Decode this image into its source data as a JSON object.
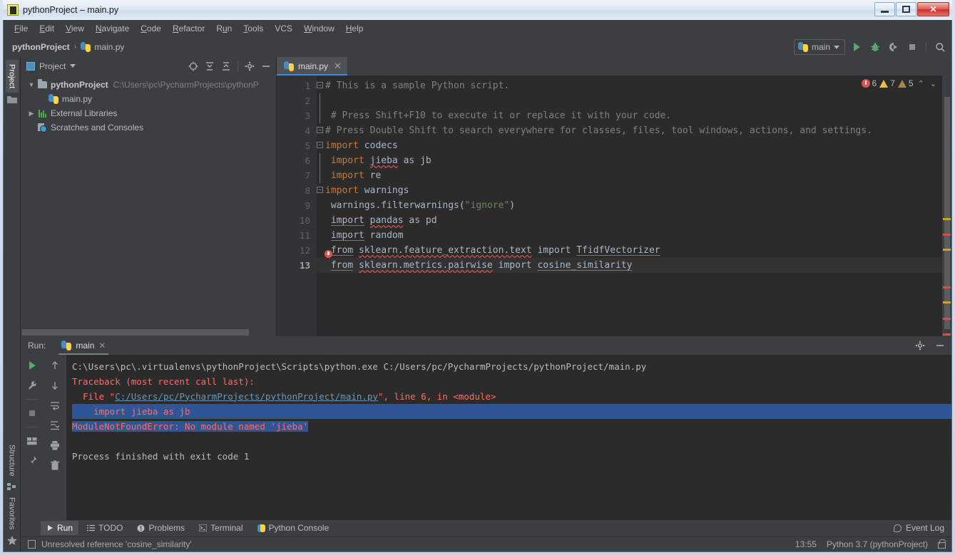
{
  "window": {
    "title": "pythonProject – main.py",
    "icon": "pycharm-icon",
    "minimize_label": "—",
    "maximize_label": "❐",
    "close_label": "✕"
  },
  "menubar": {
    "items": [
      {
        "label": "File",
        "mnemonic": "F"
      },
      {
        "label": "Edit",
        "mnemonic": "E"
      },
      {
        "label": "View",
        "mnemonic": "V"
      },
      {
        "label": "Navigate",
        "mnemonic": "N"
      },
      {
        "label": "Code",
        "mnemonic": "C"
      },
      {
        "label": "Refactor",
        "mnemonic": "R"
      },
      {
        "label": "Run",
        "mnemonic": "u"
      },
      {
        "label": "Tools",
        "mnemonic": "T"
      },
      {
        "label": "VCS",
        "mnemonic": ""
      },
      {
        "label": "Window",
        "mnemonic": "W"
      },
      {
        "label": "Help",
        "mnemonic": "H"
      }
    ]
  },
  "navbar": {
    "crumbs": [
      "pythonProject",
      "main.py"
    ],
    "separator": "›",
    "run_config": "main",
    "buttons": [
      "run-button",
      "debug-button",
      "run-coverage-button",
      "stop-button",
      "search-everywhere-button"
    ]
  },
  "left_toolbar": {
    "top": [
      "Project"
    ],
    "bottom": [
      "Structure",
      "Favorites"
    ]
  },
  "project_panel": {
    "title": "Project",
    "actions": [
      "select-opened-file-icon",
      "expand-all-icon",
      "collapse-all-icon",
      "settings-gear-icon",
      "hide-icon"
    ],
    "tree": [
      {
        "label": "pythonProject",
        "path": "C:\\Users\\pc\\PycharmProjects\\pythonP",
        "icon": "folder-icon",
        "arrow": "expanded",
        "depth": 0,
        "bold": true
      },
      {
        "label": "main.py",
        "path": "",
        "icon": "python-file-icon",
        "arrow": "none",
        "depth": 1,
        "bold": false
      },
      {
        "label": "External Libraries",
        "path": "",
        "icon": "libraries-icon",
        "arrow": "collapsed",
        "depth": 0,
        "bold": false
      },
      {
        "label": "Scratches and Consoles",
        "path": "",
        "icon": "scratches-icon",
        "arrow": "none",
        "depth": 0,
        "bold": false
      }
    ]
  },
  "editor": {
    "tabs": [
      {
        "label": "main.py",
        "icon": "python-file-icon",
        "active": true,
        "close": "✕"
      }
    ],
    "inspections": {
      "errors": "6",
      "warnings": "7",
      "weak_warnings": "5",
      "up": "⌃",
      "down": "⌄"
    },
    "current_line": 13,
    "lines": [
      {
        "num": "1",
        "fold": "start",
        "text": "# This is a sample Python script."
      },
      {
        "num": "2",
        "fold": "bar",
        "text": ""
      },
      {
        "num": "3",
        "fold": "bar",
        "text": " # Press Shift+F10 to execute it or replace it with your code."
      },
      {
        "num": "4",
        "fold": "end",
        "text": "# Press Double Shift to search everywhere for classes, files, tool windows, actions, and settings."
      },
      {
        "num": "5",
        "fold": "start",
        "text": "import codecs"
      },
      {
        "num": "6",
        "fold": "bar",
        "text": " import jieba as jb"
      },
      {
        "num": "7",
        "fold": "bar",
        "text": " import re"
      },
      {
        "num": "8",
        "fold": "end",
        "text": "import warnings"
      },
      {
        "num": "9",
        "fold": "none",
        "text": " warnings.filterwarnings(\"ignore\")"
      },
      {
        "num": "10",
        "fold": "none",
        "text": " import pandas as pd"
      },
      {
        "num": "11",
        "fold": "none",
        "text": " import random"
      },
      {
        "num": "12",
        "fold": "none",
        "text": " from sklearn.feature_extraction.text import TfidfVectorizer"
      },
      {
        "num": "13",
        "fold": "none",
        "text": " from sklearn.metrics.pairwise import cosine_similarity"
      }
    ],
    "code_tokens": {
      "l1_comment": "# This is a sample Python script.",
      "l3_comment": "# Press Shift+F10 to execute it or replace it with your code.",
      "l4_comment": "# Press Double Shift to search everywhere for classes, files, tool windows, actions, and settings.",
      "kw_import": "import",
      "kw_from": "from",
      "l5_mod": "codecs",
      "l6_mod": "jieba",
      "l6_as": "as jb",
      "l7_mod": "re",
      "l8_mod": "warnings",
      "l9_call": "warnings.filterwarnings(",
      "l9_str": "\"ignore\"",
      "l9_close": ")",
      "l10_mod": "pandas",
      "l10_as": "as pd",
      "l11_mod": "random",
      "l12_mod": "sklearn.feature_extraction.text",
      "l12_name": "TfidfVectorizer",
      "l13_mod": "sklearn.metrics.pairwise",
      "l13_name": "cosine_similarity"
    }
  },
  "run_panel": {
    "label": "Run:",
    "tab": {
      "label": "main",
      "icon": "python-icon",
      "close": "✕"
    },
    "header_actions": [
      "settings-gear-icon",
      "hide-icon"
    ],
    "side_icons_left": [
      "rerun-icon",
      "wrench-icon",
      "stop-icon",
      "layout-icon",
      "pin-icon"
    ],
    "side_icons_right": [
      "up-arrow-icon",
      "down-arrow-icon",
      "soft-wrap-icon",
      "scroll-to-end-icon",
      "print-icon",
      "trash-icon"
    ],
    "output": [
      {
        "type": "plain",
        "text": "C:\\Users\\pc\\.virtualenvs\\pythonProject\\Scripts\\python.exe C:/Users/pc/PycharmProjects/pythonProject/main.py"
      },
      {
        "type": "error",
        "text": "Traceback (most recent call last):"
      },
      {
        "type": "error-link",
        "prefix": "  File \"",
        "link": "C:/Users/pc/PycharmProjects/pythonProject/main.py",
        "suffix": "\", line 6, in <module>"
      },
      {
        "type": "error-selected",
        "text": "    import jieba as jb"
      },
      {
        "type": "error-selected",
        "text": "ModuleNotFoundError: No module named 'jieba'"
      },
      {
        "type": "blank",
        "text": ""
      },
      {
        "type": "plain",
        "text": "Process finished with exit code 1"
      }
    ]
  },
  "bottom_tabs": {
    "items": [
      {
        "label": "Run",
        "icon": "run-icon",
        "active": true
      },
      {
        "label": "TODO",
        "icon": "todo-icon",
        "active": false
      },
      {
        "label": "Problems",
        "icon": "problems-icon",
        "active": false
      },
      {
        "label": "Terminal",
        "icon": "terminal-icon",
        "active": false
      },
      {
        "label": "Python Console",
        "icon": "python-console-icon",
        "active": false
      }
    ],
    "event_log": "Event Log"
  },
  "statusbar": {
    "message": "Unresolved reference 'cosine_similarity'",
    "time": "13:55",
    "interpreter": "Python 3.7 (pythonProject)",
    "lock": "lock-icon"
  }
}
